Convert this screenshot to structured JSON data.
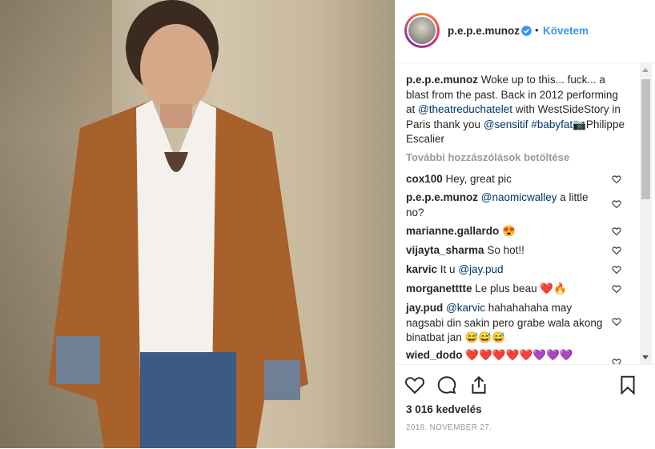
{
  "post": {
    "username": "p.e.p.e.munoz",
    "follow_label": "Követem",
    "dot": "•",
    "caption": {
      "user": "p.e.p.e.munoz",
      "t1": " Woke up to this... fuck... a blast from the past. Back in 2012 performing at ",
      "mention1": "@theatreduchatelet",
      "t2": " with WestSideStory in Paris thank you ",
      "mention2": "@sensitif",
      "t3": " ",
      "hashtag": "#babyfat",
      "camera": "📷",
      "t4": "Philippe Escalier"
    },
    "load_more": "További hozzászólások betöltése",
    "comments": [
      {
        "user": "cox100",
        "text": " Hey, great pic"
      },
      {
        "user": "p.e.p.e.munoz",
        "mention": "@naomicwalley",
        "text": " a little no?"
      },
      {
        "user": "marianne.gallardo",
        "text": " 😍"
      },
      {
        "user": "vijayta_sharma",
        "text": " So hot!!"
      },
      {
        "user": "karvic",
        "text": " It u ",
        "mention": "@jay.pud"
      },
      {
        "user": "morganetttte",
        "text": " Le plus beau ❤️🔥"
      },
      {
        "user": "jay.pud",
        "mention": "@karvic",
        "text": " hahahahaha may nagsabi din sakin pero grabe wala akong binatbat jan 😅😅😅"
      },
      {
        "user": "wied_dodo",
        "text": " ❤️❤️❤️❤️❤️💜💜💜"
      }
    ],
    "likes": "3 016 kedvelés",
    "date": "2018. NOVEMBER 27."
  },
  "colors": {
    "link": "#003569",
    "follow": "#3897f0",
    "muted": "#999999"
  },
  "icons": [
    "verified-badge-icon",
    "heart-icon",
    "comment-icon",
    "share-icon",
    "bookmark-icon",
    "camera-emoji"
  ]
}
